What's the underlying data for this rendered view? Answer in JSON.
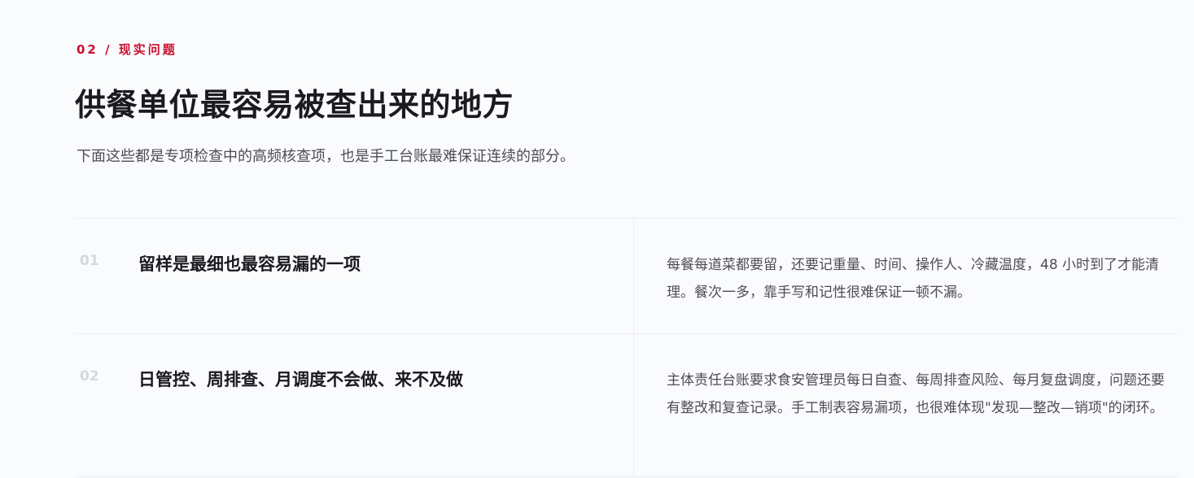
{
  "section": {
    "kicker": "02 / 现实问题",
    "title": "供餐单位最容易被查出来的地方",
    "subtitle": "下面这些都是专项检查中的高频核查项，也是手工台账最难保证连续的部分。"
  },
  "issues": [
    {
      "number": "01",
      "title": "留样是最细也最容易漏的一项",
      "description": "每餐每道菜都要留，还要记重量、时间、操作人、冷藏温度，48 小时到了才能清理。餐次一多，靠手写和记性很难保证一顿不漏。"
    },
    {
      "number": "02",
      "title": "日管控、周排查、月调度不会做、来不及做",
      "description": "主体责任台账要求食安管理员每日自查、每周排查风险、每月复盘调度，问题还要有整改和复查记录。手工制表容易漏项，也很难体现\"发现—整改—销项\"的闭环。"
    }
  ]
}
